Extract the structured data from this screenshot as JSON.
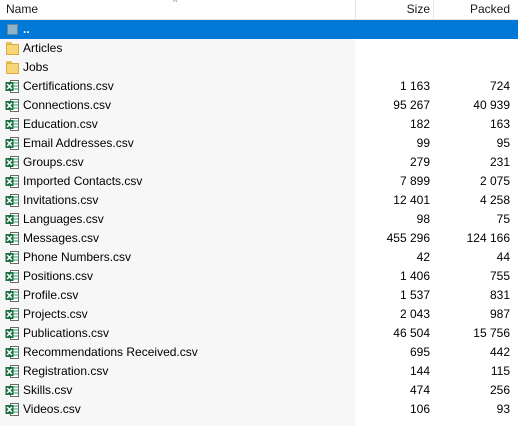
{
  "columns": {
    "name": "Name",
    "size": "Size",
    "packed": "Packed"
  },
  "icons": {
    "sort": "sort-indicator-icon",
    "folder": "folder-icon",
    "csv": "excel-csv-icon",
    "parent": "parent-folder-icon"
  },
  "colors": {
    "selection": "#0078d7",
    "excel_green": "#1d6f42",
    "folder": "#f6d676"
  },
  "parent_row": {
    "name": ".."
  },
  "folders": [
    {
      "name": "Articles"
    },
    {
      "name": "Jobs"
    }
  ],
  "files": [
    {
      "name": "Certifications.csv",
      "size": "1 163",
      "packed": "724"
    },
    {
      "name": "Connections.csv",
      "size": "95 267",
      "packed": "40 939"
    },
    {
      "name": "Education.csv",
      "size": "182",
      "packed": "163"
    },
    {
      "name": "Email Addresses.csv",
      "size": "99",
      "packed": "95"
    },
    {
      "name": "Groups.csv",
      "size": "279",
      "packed": "231"
    },
    {
      "name": "Imported Contacts.csv",
      "size": "7 899",
      "packed": "2 075"
    },
    {
      "name": "Invitations.csv",
      "size": "12 401",
      "packed": "4 258"
    },
    {
      "name": "Languages.csv",
      "size": "98",
      "packed": "75"
    },
    {
      "name": "Messages.csv",
      "size": "455 296",
      "packed": "124 166"
    },
    {
      "name": "Phone Numbers.csv",
      "size": "42",
      "packed": "44"
    },
    {
      "name": "Positions.csv",
      "size": "1 406",
      "packed": "755"
    },
    {
      "name": "Profile.csv",
      "size": "1 537",
      "packed": "831"
    },
    {
      "name": "Projects.csv",
      "size": "2 043",
      "packed": "987"
    },
    {
      "name": "Publications.csv",
      "size": "46 504",
      "packed": "15 756"
    },
    {
      "name": "Recommendations Received.csv",
      "size": "695",
      "packed": "442"
    },
    {
      "name": "Registration.csv",
      "size": "144",
      "packed": "115"
    },
    {
      "name": "Skills.csv",
      "size": "474",
      "packed": "256"
    },
    {
      "name": "Videos.csv",
      "size": "106",
      "packed": "93"
    }
  ]
}
